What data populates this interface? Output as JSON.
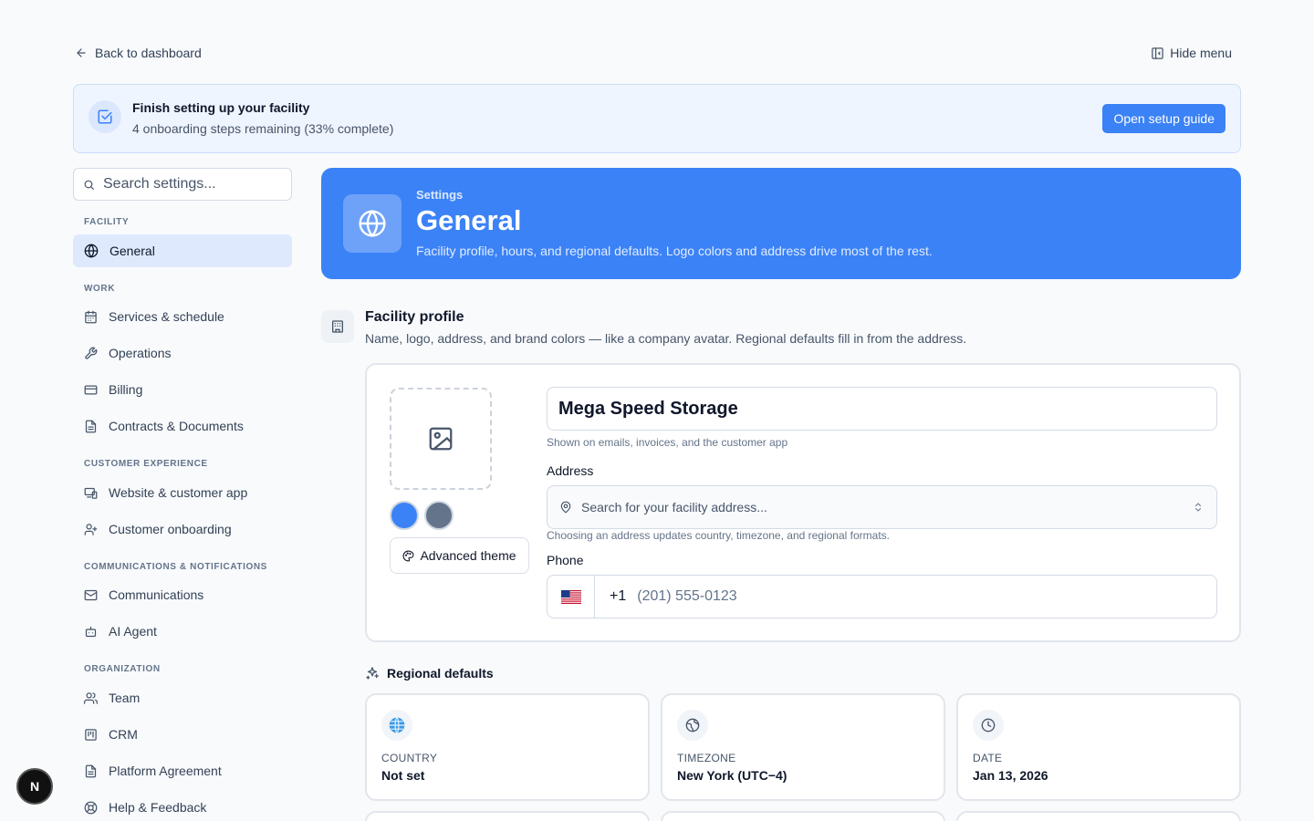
{
  "topbar": {
    "back_label": "Back to dashboard",
    "hide_menu_label": "Hide menu"
  },
  "banner": {
    "title": "Finish setting up your facility",
    "subtitle": "4 onboarding steps remaining (33% complete)",
    "button_label": "Open setup guide",
    "progress_percent": 33
  },
  "sidebar": {
    "search_placeholder": "Search settings...",
    "sections": [
      {
        "label": "FACILITY",
        "items": [
          {
            "label": "General",
            "icon": "globe-icon",
            "active": true
          }
        ]
      },
      {
        "label": "WORK",
        "items": [
          {
            "label": "Services & schedule",
            "icon": "calendar-icon"
          },
          {
            "label": "Operations",
            "icon": "wrench-icon"
          },
          {
            "label": "Billing",
            "icon": "credit-card-icon"
          },
          {
            "label": "Contracts & Documents",
            "icon": "document-icon"
          }
        ]
      },
      {
        "label": "CUSTOMER EXPERIENCE",
        "items": [
          {
            "label": "Website & customer app",
            "icon": "devices-icon"
          },
          {
            "label": "Customer onboarding",
            "icon": "user-plus-icon"
          }
        ]
      },
      {
        "label": "COMMUNICATIONS & NOTIFICATIONS",
        "items": [
          {
            "label": "Communications",
            "icon": "mail-icon"
          },
          {
            "label": "AI Agent",
            "icon": "bot-icon"
          }
        ]
      },
      {
        "label": "ORGANIZATION",
        "items": [
          {
            "label": "Team",
            "icon": "users-icon"
          },
          {
            "label": "CRM",
            "icon": "kanban-icon"
          },
          {
            "label": "Platform Agreement",
            "icon": "file-text-icon"
          },
          {
            "label": "Help & Feedback",
            "icon": "life-buoy-icon"
          }
        ]
      }
    ]
  },
  "avatar_letter": "N",
  "hero": {
    "eyebrow": "Settings",
    "title": "General",
    "description": "Facility profile, hours, and regional defaults. Logo colors and address drive most of the rest.",
    "background": "#3b82f6"
  },
  "facility_profile": {
    "title": "Facility profile",
    "description": "Name, logo, address, and brand colors — like a company avatar. Regional defaults fill in from the address.",
    "brand_colors": [
      "#3b82f6",
      "#64748b"
    ],
    "advanced_theme_label": "Advanced theme",
    "name_value": "Mega Speed Storage",
    "name_hint": "Shown on emails, invoices, and the customer app",
    "address_label": "Address",
    "address_placeholder": "Search for your facility address...",
    "address_hint": "Choosing an address updates country, timezone, and regional formats.",
    "phone_label": "Phone",
    "phone_flag": "🇺🇸",
    "phone_code": "+1",
    "phone_placeholder": "(201) 555-0123"
  },
  "regional": {
    "title": "Regional defaults",
    "cards": [
      {
        "label": "COUNTRY",
        "value": "Not set",
        "icon": "globe-emoji-icon"
      },
      {
        "label": "TIMEZONE",
        "value": "New York (UTC−4)",
        "icon": "world-icon"
      },
      {
        "label": "DATE",
        "value": "Jan 13, 2026",
        "icon": "clock-icon"
      }
    ]
  }
}
